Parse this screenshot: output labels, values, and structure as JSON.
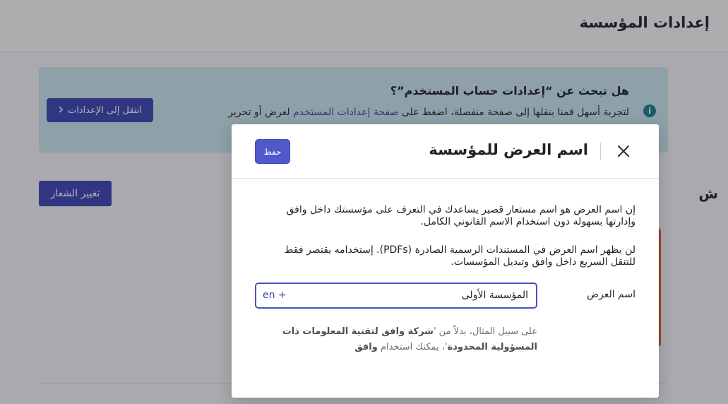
{
  "page": {
    "title": "إعدادات المؤسسة",
    "section_glyph": "ش"
  },
  "banner": {
    "title": "هل تبحث عن “إعدادات حساب المستخدم”؟",
    "text_before": "لتجربة أسهل قمنا بنقلها إلى صفحة منفصلة، اضغط على ",
    "link": "صفحة إعدادات المستخدم",
    "text_after": " لعرض أو تحرير",
    "button_label": "انتقل إلى الإعدادات",
    "button_icon": "chevron-right-icon",
    "info_icon": "i"
  },
  "logo_button_label": "تغيير الشعار",
  "modal": {
    "title": "اسم العرض للمؤسسة",
    "save_label": "حفظ",
    "close_icon": "close-icon",
    "paragraph1": "إن اسم العرض هو اسم مستعار قصير يساعدك في التعرف على مؤسستك داخل وافق وإدارتها بسهولة دون استخدام الاسم القانوني الكامل.",
    "paragraph2": "لن يظهر اسم العرض في المستندات الرسمية الصادرة (PDFs). إستخدامه يقتصر فقط للتنقل السريع داخل وافق وتبديل المؤسسات.",
    "field_label": "اسم العرض",
    "field_value": "المؤسسة الأولى",
    "lang_add": "en +",
    "hint_prefix": "على سبيل المثال، بدلاً من '",
    "hint_legal_name": "شركة وافق لتقنية المعلومات ذات المسؤولية المحدودة",
    "hint_middle": "'، يمكنك استخدام ",
    "hint_short_name": "وافق"
  },
  "colors": {
    "primary": "#3c44b5",
    "banner_bg": "#cbe9ef",
    "info_icon": "#1b7f8c",
    "accent_orange": "#e8552d",
    "link": "#3a46b5"
  }
}
